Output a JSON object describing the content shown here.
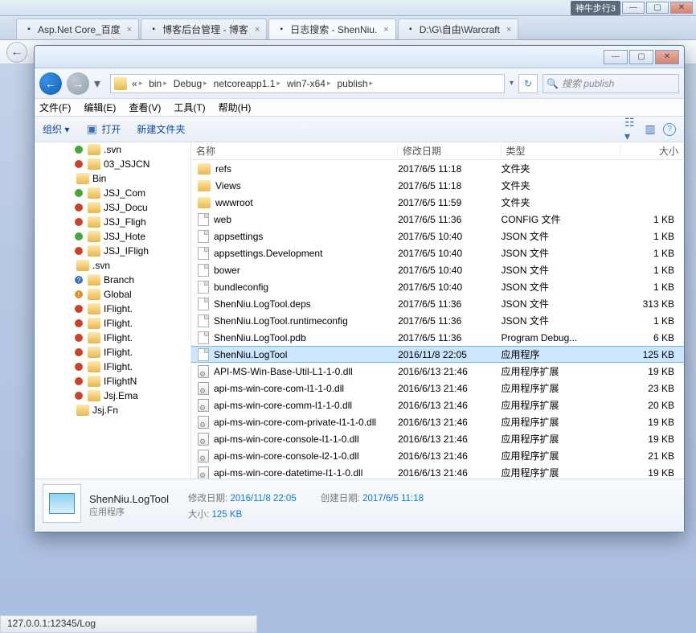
{
  "browser": {
    "badge1": "神牛步行3",
    "tabs": [
      {
        "label": "Asp.Net Core_百度",
        "active": false
      },
      {
        "label": "博客后台管理 - 博客",
        "active": false
      },
      {
        "label": "日志搜索 - ShenNiu.",
        "active": true
      },
      {
        "label": "D:\\G\\自由\\Warcraft",
        "active": false
      }
    ]
  },
  "explorer": {
    "breadcrumb": [
      "bin",
      "Debug",
      "netcoreapp1.1",
      "win7-x64",
      "publish"
    ],
    "search_placeholder": "搜索 publish",
    "menu": {
      "file": "文件(F)",
      "edit": "编辑(E)",
      "view": "查看(V)",
      "tools": "工具(T)",
      "help": "帮助(H)"
    },
    "cmd": {
      "organize": "组织 ▾",
      "open": "打开",
      "newfolder": "新建文件夹"
    },
    "columns": {
      "name": "名称",
      "date": "修改日期",
      "type": "类型",
      "size": "大小"
    },
    "tree": [
      {
        "label": ".svn",
        "indent": "subsub",
        "badge": "green"
      },
      {
        "label": "03_JSJCN",
        "indent": "subsub",
        "badge": "red"
      },
      {
        "label": "Bin",
        "indent": "subsub",
        "badge": ""
      },
      {
        "label": "JSJ_Com",
        "indent": "subsub",
        "badge": "green"
      },
      {
        "label": "JSJ_Docu",
        "indent": "subsub",
        "badge": "red"
      },
      {
        "label": "JSJ_Fligh",
        "indent": "subsub",
        "badge": "red"
      },
      {
        "label": "JSJ_Hote",
        "indent": "subsub",
        "badge": "green"
      },
      {
        "label": "JSJ_IFligh",
        "indent": "subsub",
        "badge": "red"
      },
      {
        "label": ".svn",
        "indent": "subsub",
        "badge": "",
        "extra": true
      },
      {
        "label": "Branch",
        "indent": "subsub",
        "badge": "q",
        "extra": true
      },
      {
        "label": "Global",
        "indent": "subsub",
        "badge": "ex",
        "extra": true
      },
      {
        "label": "IFlight.",
        "indent": "subsub",
        "badge": "red",
        "extra": true
      },
      {
        "label": "IFlight.",
        "indent": "subsub",
        "badge": "red",
        "extra": true
      },
      {
        "label": "IFlight.",
        "indent": "subsub",
        "badge": "red",
        "extra": true
      },
      {
        "label": "IFlight.",
        "indent": "subsub",
        "badge": "red",
        "extra": true
      },
      {
        "label": "IFlight.",
        "indent": "subsub",
        "badge": "red",
        "extra": true
      },
      {
        "label": "IFlightN",
        "indent": "subsub",
        "badge": "red",
        "extra": true
      },
      {
        "label": "Jsj.Ema",
        "indent": "subsub",
        "badge": "red",
        "extra": true
      },
      {
        "label": "Jsj.Fn",
        "indent": "subsub",
        "badge": "",
        "extra": true
      }
    ],
    "files": [
      {
        "name": "refs",
        "date": "2017/6/5 11:18",
        "type": "文件夹",
        "size": "",
        "icon": "folder"
      },
      {
        "name": "Views",
        "date": "2017/6/5 11:18",
        "type": "文件夹",
        "size": "",
        "icon": "folder"
      },
      {
        "name": "wwwroot",
        "date": "2017/6/5 11:59",
        "type": "文件夹",
        "size": "",
        "icon": "folder"
      },
      {
        "name": "web",
        "date": "2017/6/5 11:36",
        "type": "CONFIG 文件",
        "size": "1 KB",
        "icon": "file"
      },
      {
        "name": "appsettings",
        "date": "2017/6/5 10:40",
        "type": "JSON 文件",
        "size": "1 KB",
        "icon": "file"
      },
      {
        "name": "appsettings.Development",
        "date": "2017/6/5 10:40",
        "type": "JSON 文件",
        "size": "1 KB",
        "icon": "file"
      },
      {
        "name": "bower",
        "date": "2017/6/5 10:40",
        "type": "JSON 文件",
        "size": "1 KB",
        "icon": "file"
      },
      {
        "name": "bundleconfig",
        "date": "2017/6/5 10:40",
        "type": "JSON 文件",
        "size": "1 KB",
        "icon": "file"
      },
      {
        "name": "ShenNiu.LogTool.deps",
        "date": "2017/6/5 11:36",
        "type": "JSON 文件",
        "size": "313 KB",
        "icon": "file"
      },
      {
        "name": "ShenNiu.LogTool.runtimeconfig",
        "date": "2017/6/5 11:36",
        "type": "JSON 文件",
        "size": "1 KB",
        "icon": "file"
      },
      {
        "name": "ShenNiu.LogTool.pdb",
        "date": "2017/6/5 11:36",
        "type": "Program Debug...",
        "size": "6 KB",
        "icon": "file"
      },
      {
        "name": "ShenNiu.LogTool",
        "date": "2016/11/8 22:05",
        "type": "应用程序",
        "size": "125 KB",
        "icon": "file",
        "selected": true
      },
      {
        "name": "API-MS-Win-Base-Util-L1-1-0.dll",
        "date": "2016/6/13 21:46",
        "type": "应用程序扩展",
        "size": "19 KB",
        "icon": "dll"
      },
      {
        "name": "api-ms-win-core-com-l1-1-0.dll",
        "date": "2016/6/13 21:46",
        "type": "应用程序扩展",
        "size": "23 KB",
        "icon": "dll"
      },
      {
        "name": "api-ms-win-core-comm-l1-1-0.dll",
        "date": "2016/6/13 21:46",
        "type": "应用程序扩展",
        "size": "20 KB",
        "icon": "dll"
      },
      {
        "name": "api-ms-win-core-com-private-l1-1-0.dll",
        "date": "2016/6/13 21:46",
        "type": "应用程序扩展",
        "size": "19 KB",
        "icon": "dll"
      },
      {
        "name": "api-ms-win-core-console-l1-1-0.dll",
        "date": "2016/6/13 21:46",
        "type": "应用程序扩展",
        "size": "19 KB",
        "icon": "dll"
      },
      {
        "name": "api-ms-win-core-console-l2-1-0.dll",
        "date": "2016/6/13 21:46",
        "type": "应用程序扩展",
        "size": "21 KB",
        "icon": "dll"
      },
      {
        "name": "api-ms-win-core-datetime-l1-1-0.dll",
        "date": "2016/6/13 21:46",
        "type": "应用程序扩展",
        "size": "19 KB",
        "icon": "dll"
      }
    ],
    "details": {
      "name": "ShenNiu.LogTool",
      "kind": "应用程序",
      "mod_k": "修改日期:",
      "mod_v": "2016/11/8 22:05",
      "cre_k": "创建日期:",
      "cre_v": "2017/6/5 11:18",
      "siz_k": "大小:",
      "siz_v": "125 KB"
    }
  },
  "status": "127.0.0.1:12345/Log"
}
